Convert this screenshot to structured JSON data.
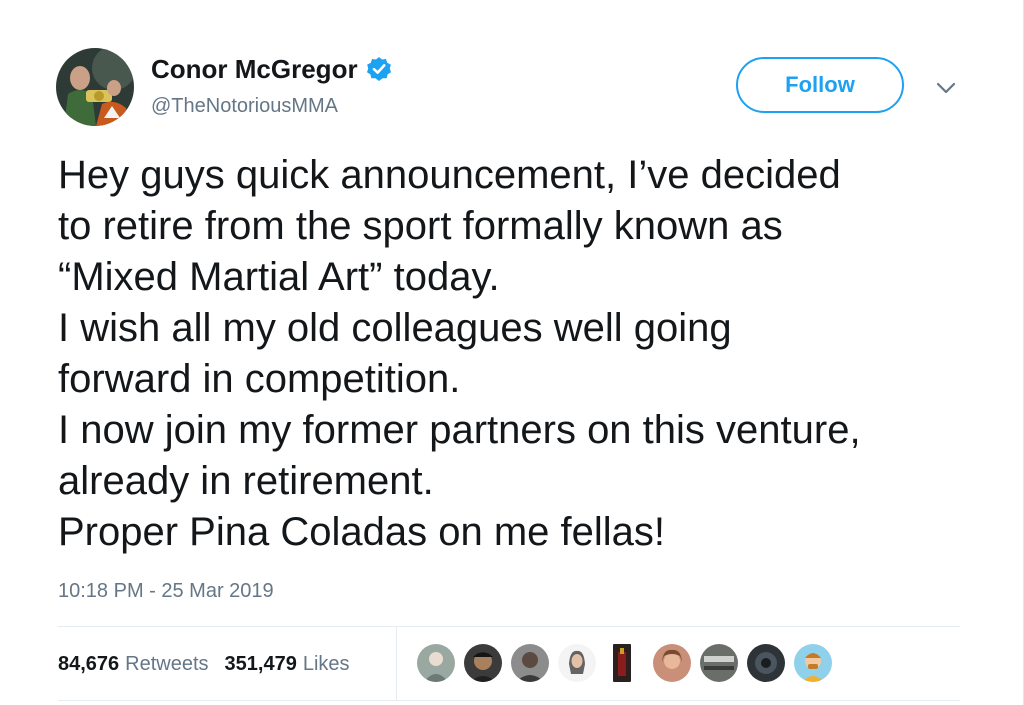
{
  "author": {
    "display_name": "Conor McGregor",
    "handle": "@TheNotoriousMMA",
    "verified": true,
    "avatar_icon": "profile-photo"
  },
  "actions": {
    "follow_label": "Follow",
    "more_icon": "chevron-down-icon"
  },
  "tweet": {
    "lines": [
      "Hey guys quick announcement, I’ve decided",
      "to retire from the sport formally known as",
      "“Mixed Martial Art” today.",
      "I wish all my old colleagues well going",
      "forward in competition.",
      "I now join my former partners on this venture,",
      "already in retirement.",
      "Proper Pina Coladas on me fellas!"
    ],
    "timestamp": "10:18 PM - 25 Mar 2019"
  },
  "stats": {
    "retweets_count": "84,676",
    "retweets_label": "Retweets",
    "likes_count": "351,479",
    "likes_label": "Likes"
  },
  "likers": [
    {
      "icon": "liker-avatar",
      "color": "#6b7a74"
    },
    {
      "icon": "liker-avatar",
      "color": "#3b3b3b"
    },
    {
      "icon": "liker-avatar",
      "color": "#5a4a40"
    },
    {
      "icon": "liker-avatar",
      "color": "#4a4a4a"
    },
    {
      "icon": "liker-avatar",
      "color": "#d9b9a8"
    },
    {
      "icon": "liker-avatar",
      "color": "#2a2020"
    },
    {
      "icon": "liker-avatar",
      "color": "#c98f78"
    },
    {
      "icon": "liker-avatar",
      "color": "#6a6e6a"
    },
    {
      "icon": "liker-avatar",
      "color": "#2e3338"
    },
    {
      "icon": "liker-avatar",
      "color": "#8fd0ea"
    }
  ],
  "colors": {
    "accent": "#1da1f2",
    "text": "#14171a",
    "secondary": "#657786",
    "divider": "#e6ecf0"
  }
}
